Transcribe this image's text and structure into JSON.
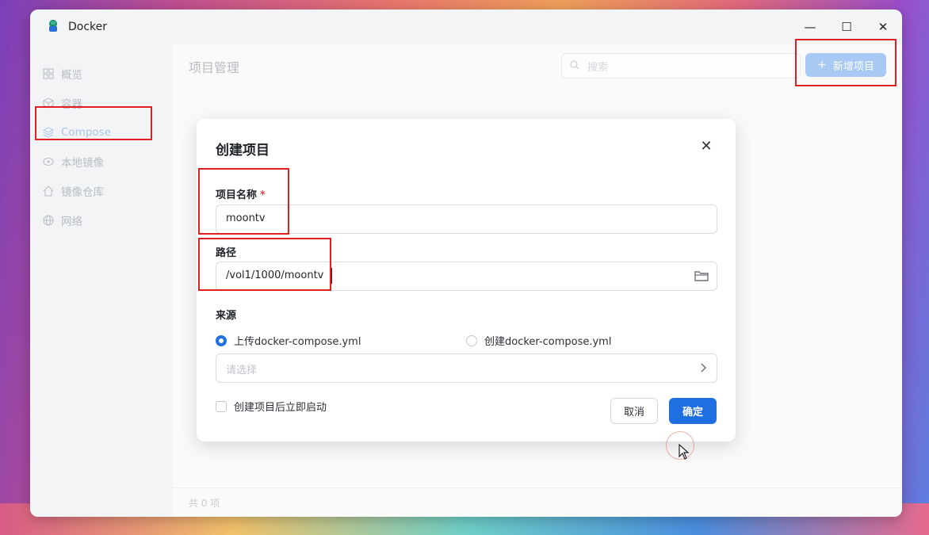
{
  "app": {
    "title": "Docker"
  },
  "window_controls": {
    "minimize": "—",
    "maximize": "☐",
    "close": "✕"
  },
  "sidebar": {
    "items": [
      {
        "label": "概览",
        "icon": "grid-icon"
      },
      {
        "label": "容器",
        "icon": "cube-icon"
      },
      {
        "label": "Compose",
        "icon": "layers-icon",
        "active": true
      },
      {
        "label": "本地镜像",
        "icon": "disk-icon"
      },
      {
        "label": "镜像仓库",
        "icon": "home-icon"
      },
      {
        "label": "网络",
        "icon": "globe-icon"
      }
    ]
  },
  "main": {
    "title": "项目管理",
    "search_placeholder": "搜索",
    "add_button": "新增项目",
    "add_button_icon": "+",
    "total": "共 0 项"
  },
  "dialog": {
    "title": "创建项目",
    "close": "✕",
    "name_label": "项目名称",
    "required_mark": "*",
    "name_value": "moontv",
    "path_label": "路径",
    "path_value": "/vol1/1000/moontv",
    "source_label": "来源",
    "source_options": [
      "上传docker-compose.yml",
      "创建docker-compose.yml"
    ],
    "source_selected": 0,
    "select_placeholder": "请选择",
    "start_after_create": "创建项目后立即启动",
    "cancel": "取消",
    "confirm": "确定"
  },
  "colors": {
    "accent": "#1f6fe0",
    "highlight": "#e02020",
    "required": "#e5484d"
  }
}
